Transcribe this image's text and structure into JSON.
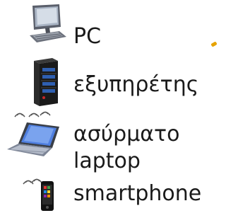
{
  "legend": {
    "items": [
      {
        "icon": "desktop-pc-icon",
        "label": "PC"
      },
      {
        "icon": "server-tower-icon",
        "label": "εξυπηρέτης"
      },
      {
        "icon": "wireless-laptop-icon",
        "label": "ασύρματο\nlaptop",
        "label_line1": "ασύρματο",
        "label_line2": "laptop"
      },
      {
        "icon": "smartphone-icon",
        "label": "smartphone"
      }
    ]
  },
  "colors": {
    "accent": "#e6a300",
    "text": "#1a1a1a",
    "screen_blue": "#3a6fd8",
    "server_black": "#111111"
  }
}
